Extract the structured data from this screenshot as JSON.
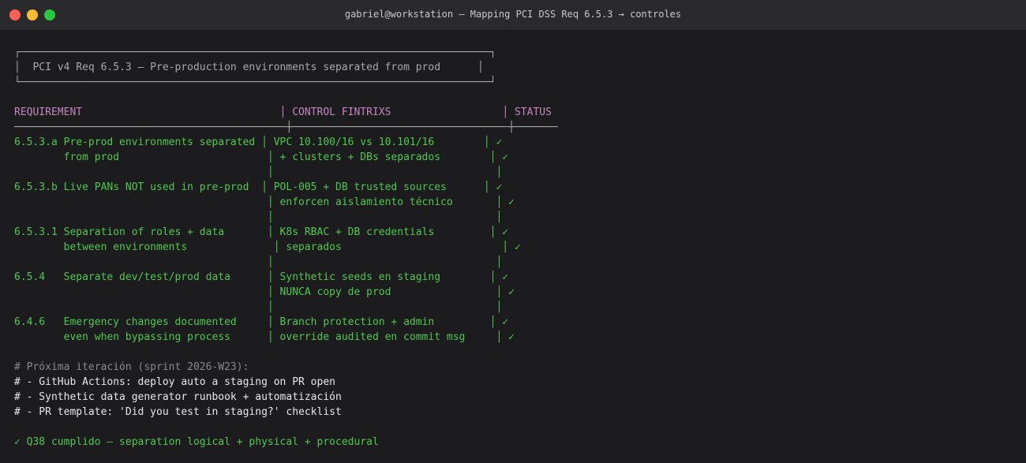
{
  "window": {
    "title": "gabriel@workstation — Mapping PCI DSS Req 6.5.3 → controles",
    "colors": {
      "close": "#ff5f57",
      "minimize": "#febc2e",
      "zoom": "#28c840"
    }
  },
  "terminal": {
    "banner": {
      "top": "┌────────────────────────────────────────────────────────────────────────────┐",
      "text": "│  PCI v4 Req 6.5.3 — Pre-production environments separated from prod      │",
      "bottom": "└────────────────────────────────────────────────────────────────────────────┘"
    },
    "header": {
      "col1": "REQUIREMENT                                ",
      "sep1": "│",
      "col2": " CONTROL FINTRIXS                  ",
      "sep2": "│",
      "col3": " STATUS"
    },
    "rule": "────────────────────────────────────────────┼───────────────────────────────────┼───────",
    "rows": [
      {
        "line": "6.5.3.a Pre-prod environments separated │ VPC 10.100/16 vs 10.101/16        │ ✓"
      },
      {
        "line": "        from prod                        │ + clusters + DBs separados        │ ✓"
      },
      {
        "line": "                                         │                                    │"
      },
      {
        "line": "6.5.3.b Live PANs NOT used in pre-prod  │ POL-005 + DB trusted sources      │ ✓"
      },
      {
        "line": "                                         │ enforcen aislamiento técnico       │ ✓"
      },
      {
        "line": "                                         │                                    │"
      },
      {
        "line": "6.5.3.1 Separation of roles + data       │ K8s RBAC + DB credentials         │ ✓"
      },
      {
        "line": "        between environments              │ separados                          │ ✓"
      },
      {
        "line": "                                         │                                    │"
      },
      {
        "line": "6.5.4   Separate dev/test/prod data      │ Synthetic seeds en staging        │ ✓"
      },
      {
        "line": "                                         │ NUNCA copy de prod                 │ ✓"
      },
      {
        "line": "                                         │                                    │"
      },
      {
        "line": "6.4.6   Emergency changes documented     │ Branch protection + admin         │ ✓"
      },
      {
        "line": "        even when bypassing process      │ override audited en commit msg     │ ✓"
      }
    ],
    "comment_header": "# Próxima iteración (sprint 2026-W23):",
    "todo": [
      "# - GitHub Actions: deploy auto a staging on PR open",
      "# - Synthetic data generator runbook + automatización",
      "# - PR template: 'Did you test in staging?' checklist"
    ],
    "result": "✓ Q38 cumplido — separation logical + physical + procedural"
  }
}
